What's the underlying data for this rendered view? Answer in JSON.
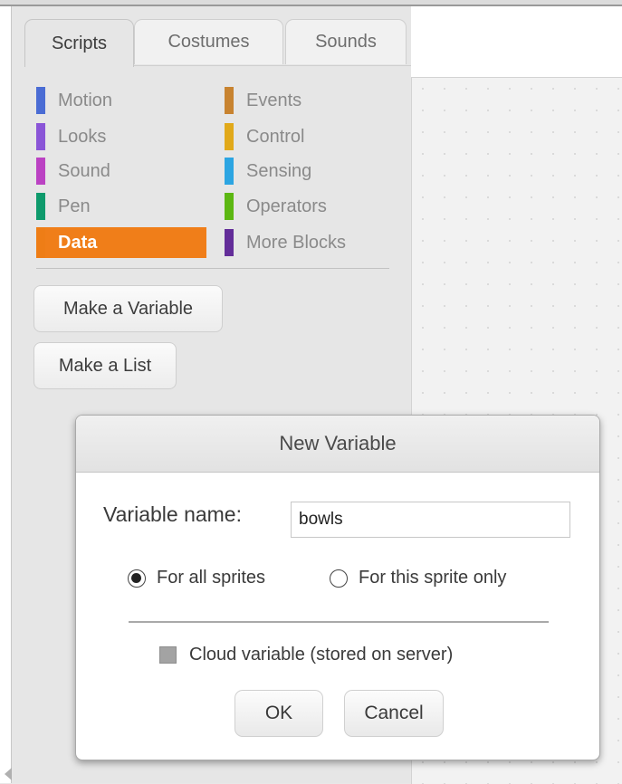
{
  "tabs": [
    {
      "label": "Scripts",
      "active": true
    },
    {
      "label": "Costumes",
      "active": false
    },
    {
      "label": "Sounds",
      "active": false
    }
  ],
  "categories_left": [
    {
      "label": "Motion",
      "color": "#4a6cd4"
    },
    {
      "label": "Looks",
      "color": "#8a55d7"
    },
    {
      "label": "Sound",
      "color": "#bb42c3"
    },
    {
      "label": "Pen",
      "color": "#0e9a6c"
    },
    {
      "label": "Data",
      "color": "#ee7d16",
      "active": true
    }
  ],
  "categories_right": [
    {
      "label": "Events",
      "color": "#c88330"
    },
    {
      "label": "Control",
      "color": "#e1a91a"
    },
    {
      "label": "Sensing",
      "color": "#2ca5e2"
    },
    {
      "label": "Operators",
      "color": "#5cb712"
    },
    {
      "label": "More Blocks",
      "color": "#632d99"
    }
  ],
  "buttons": {
    "make_variable": "Make a Variable",
    "make_list": "Make a List"
  },
  "dialog": {
    "title": "New Variable",
    "variable_name_label": "Variable name:",
    "variable_name_value": "bowls",
    "radio_all_sprites": "For all sprites",
    "radio_this_sprite": "For this sprite only",
    "selected_scope": "For all sprites",
    "cloud_label": "Cloud variable (stored on server)",
    "cloud_checked": false,
    "ok_label": "OK",
    "cancel_label": "Cancel"
  }
}
